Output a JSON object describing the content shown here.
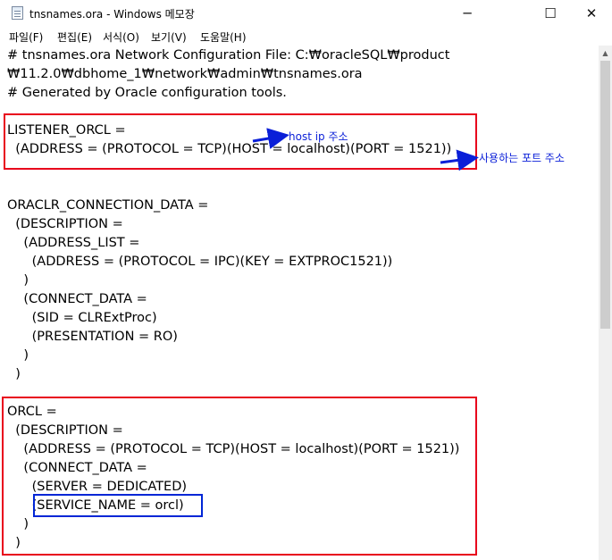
{
  "window": {
    "title": "tnsnames.ora - Windows 메모장",
    "minimize_glyph": "─",
    "maximize_glyph": "☐",
    "close_glyph": "✕"
  },
  "menu": [
    "파일(F)",
    "편집(E)",
    "서식(O)",
    "보기(V)",
    "도움말(H)"
  ],
  "editor_lines": [
    "# tnsnames.ora Network Configuration File: C:₩oracleSQL₩product",
    "₩11.2.0₩dbhome_1₩network₩admin₩tnsnames.ora",
    "# Generated by Oracle configuration tools.",
    "",
    "LISTENER_ORCL =",
    "  (ADDRESS = (PROTOCOL = TCP)(HOST = localhost)(PORT = 1521))",
    "",
    "",
    "ORACLR_CONNECTION_DATA =",
    "  (DESCRIPTION =",
    "    (ADDRESS_LIST =",
    "      (ADDRESS = (PROTOCOL = IPC)(KEY = EXTPROC1521))",
    "    )",
    "    (CONNECT_DATA =",
    "      (SID = CLRExtProc)",
    "      (PRESENTATION = RO)",
    "    )",
    "  )",
    "",
    "ORCL =",
    "  (DESCRIPTION =",
    "    (ADDRESS = (PROTOCOL = TCP)(HOST = localhost)(PORT = 1521))",
    "    (CONNECT_DATA =",
    "      (SERVER = DEDICATED)",
    "      (SERVICE_NAME = orcl)",
    "    )",
    "  )"
  ],
  "annotations": {
    "host_note": "host ip 주소",
    "port_note": "사용하는 포트 주소",
    "annotation_color": "#0a1fd8",
    "red_box_color": "#e8001c",
    "blue_box_color": "#0026d6"
  }
}
